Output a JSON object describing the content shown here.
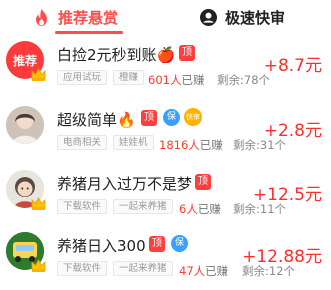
{
  "tabs": [
    {
      "label": "推荐悬赏",
      "active": true
    },
    {
      "label": "极速快审",
      "active": false
    }
  ],
  "colors": {
    "accent": "#ff4d4d",
    "reward": "#ff2d2d",
    "shield": "#3aa0ff",
    "fast": "#ffb300"
  },
  "tasks": [
    {
      "avatar_text": "推荐",
      "title": "白捡2元秒到账🍎",
      "badges": [
        "顶"
      ],
      "tags": [
        "应用试玩",
        "橙赚"
      ],
      "earned_count": "601人",
      "earned_suffix": "已赚",
      "remaining": "剩余:78个",
      "reward": "+8.7元"
    },
    {
      "title": "超级简单🔥",
      "badges": [
        "顶",
        "保",
        "快审"
      ],
      "tags": [
        "电商相关",
        "娃娃机"
      ],
      "earned_count": "1816人",
      "earned_suffix": "已赚",
      "remaining": "剩余:31个",
      "reward": "+2.8元"
    },
    {
      "title": "养猪月入过万不是梦",
      "badges": [
        "顶"
      ],
      "tags": [
        "下载软件",
        "一起来养猪"
      ],
      "earned_count": "6人",
      "earned_suffix": "已赚",
      "remaining": "剩余:11个",
      "reward": "+12.5元"
    },
    {
      "title": "养猪日入300",
      "badges": [
        "顶",
        "保"
      ],
      "tags": [
        "下载软件",
        "一起来养猪"
      ],
      "earned_count": "47人",
      "earned_suffix": "已赚",
      "remaining": "剩余:12个",
      "reward": "+12.88元"
    }
  ]
}
